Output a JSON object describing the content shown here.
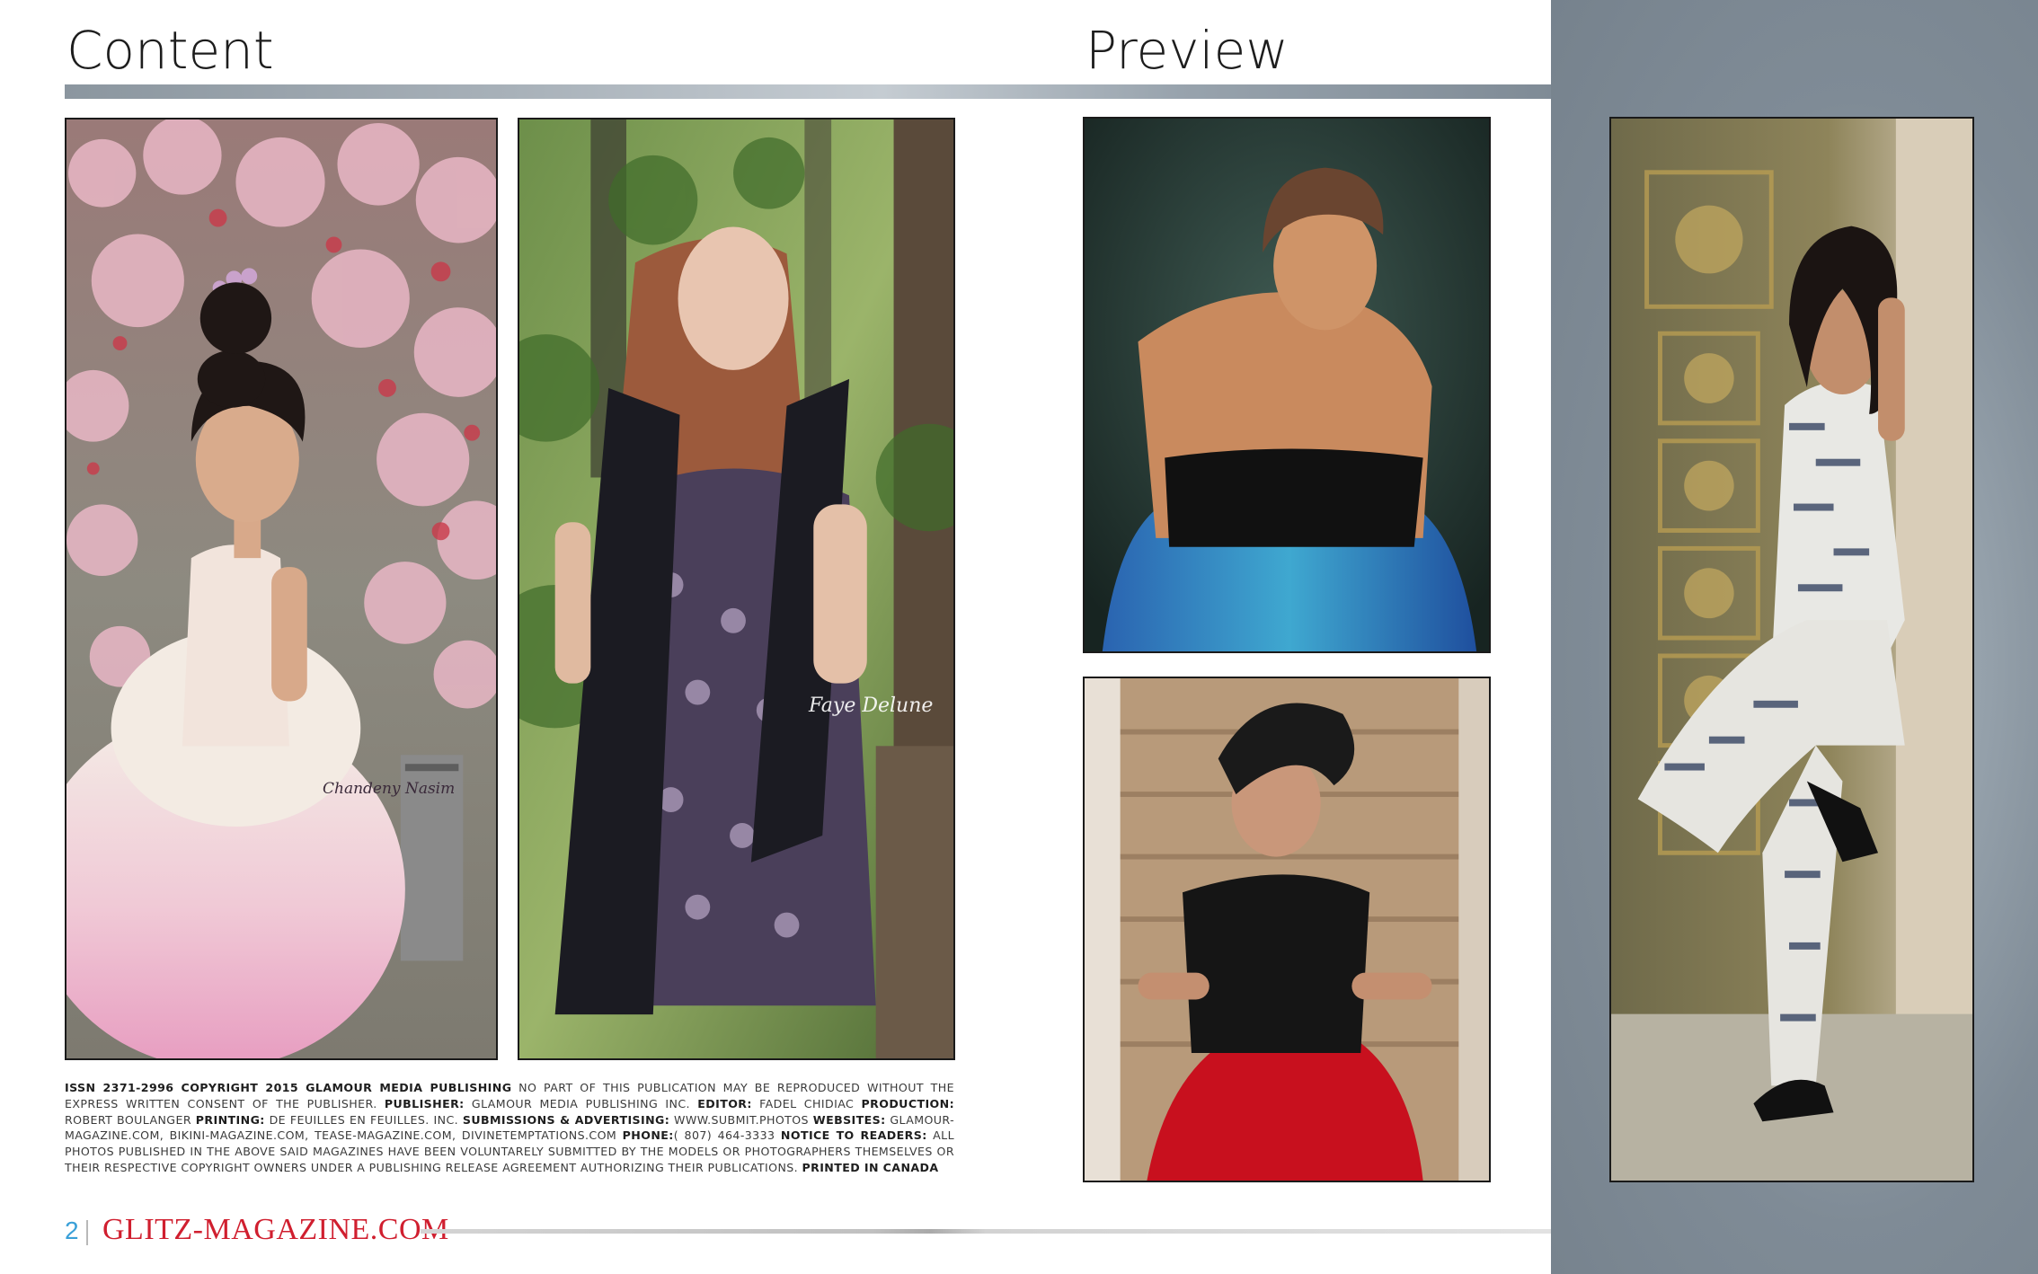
{
  "headings": {
    "content": "Content",
    "preview": "Preview"
  },
  "photos": {
    "p1": {
      "watermark": "Chandeny Nasim"
    },
    "p2": {
      "watermark": "Faye Delune"
    }
  },
  "colophon": {
    "issn": "ISSN 2371-2996 COPYRIGHT 2015 GLAMOUR MEDIA PUBLISHING",
    "issn_text": " NO PART OF THIS PUBLICATION MAY BE REPRODUCED WITHOUT THE EXPRESS WRITTEN CONSENT OF THE PUBLISHER. ",
    "publisher_label": "PUBLISHER:",
    "publisher": " GLAMOUR MEDIA PUBLISHING INC. ",
    "editor_label": "EDITOR:",
    "editor": " FADEL CHIDIAC ",
    "production_label": "PRODUCTION:",
    "production": " ROBERT BOULANGER ",
    "printing_label": "PRINTING:",
    "printing": " DE FEUILLES EN FEUILLES. INC. ",
    "submissions_label": "SUBMISSIONS & ADVERTISING:",
    "submissions": " WWW.SUBMIT.PHOTOS ",
    "websites_label": "WEBSITES:",
    "websites": " GLAMOUR-MAGAZINE.COM, BIKINI-MAGAZINE.COM, TEASE-MAGAZINE.COM, DIVINETEMPTATIONS.COM ",
    "phone_label": "PHONE:",
    "phone": "( 807) 464-3333 ",
    "notice_label": "NOTICE TO READERS:",
    "notice": " ALL PHOTOS PUBLISHED IN THE ABOVE SAID MAGAZINES HAVE BEEN VOLUNTARELY SUBMITTED BY THE MODELS OR PHOTOGRAPHERS THEMSELVES OR THEIR RESPECTIVE COPYRIGHT OWNERS UNDER A PUBLISHING RELEASE AGREEMENT AUTHORIZING THEIR PUBLICATIONS. ",
    "printed": "PRINTED IN CANADA"
  },
  "footer": {
    "page_number": "2",
    "separator": "|",
    "brand": "GLITZ-MAGAZINE.COM"
  },
  "colors": {
    "brand_red": "#d01f2f",
    "page_number_blue": "#3aa0d8",
    "right_panel": "#7f8b96"
  }
}
